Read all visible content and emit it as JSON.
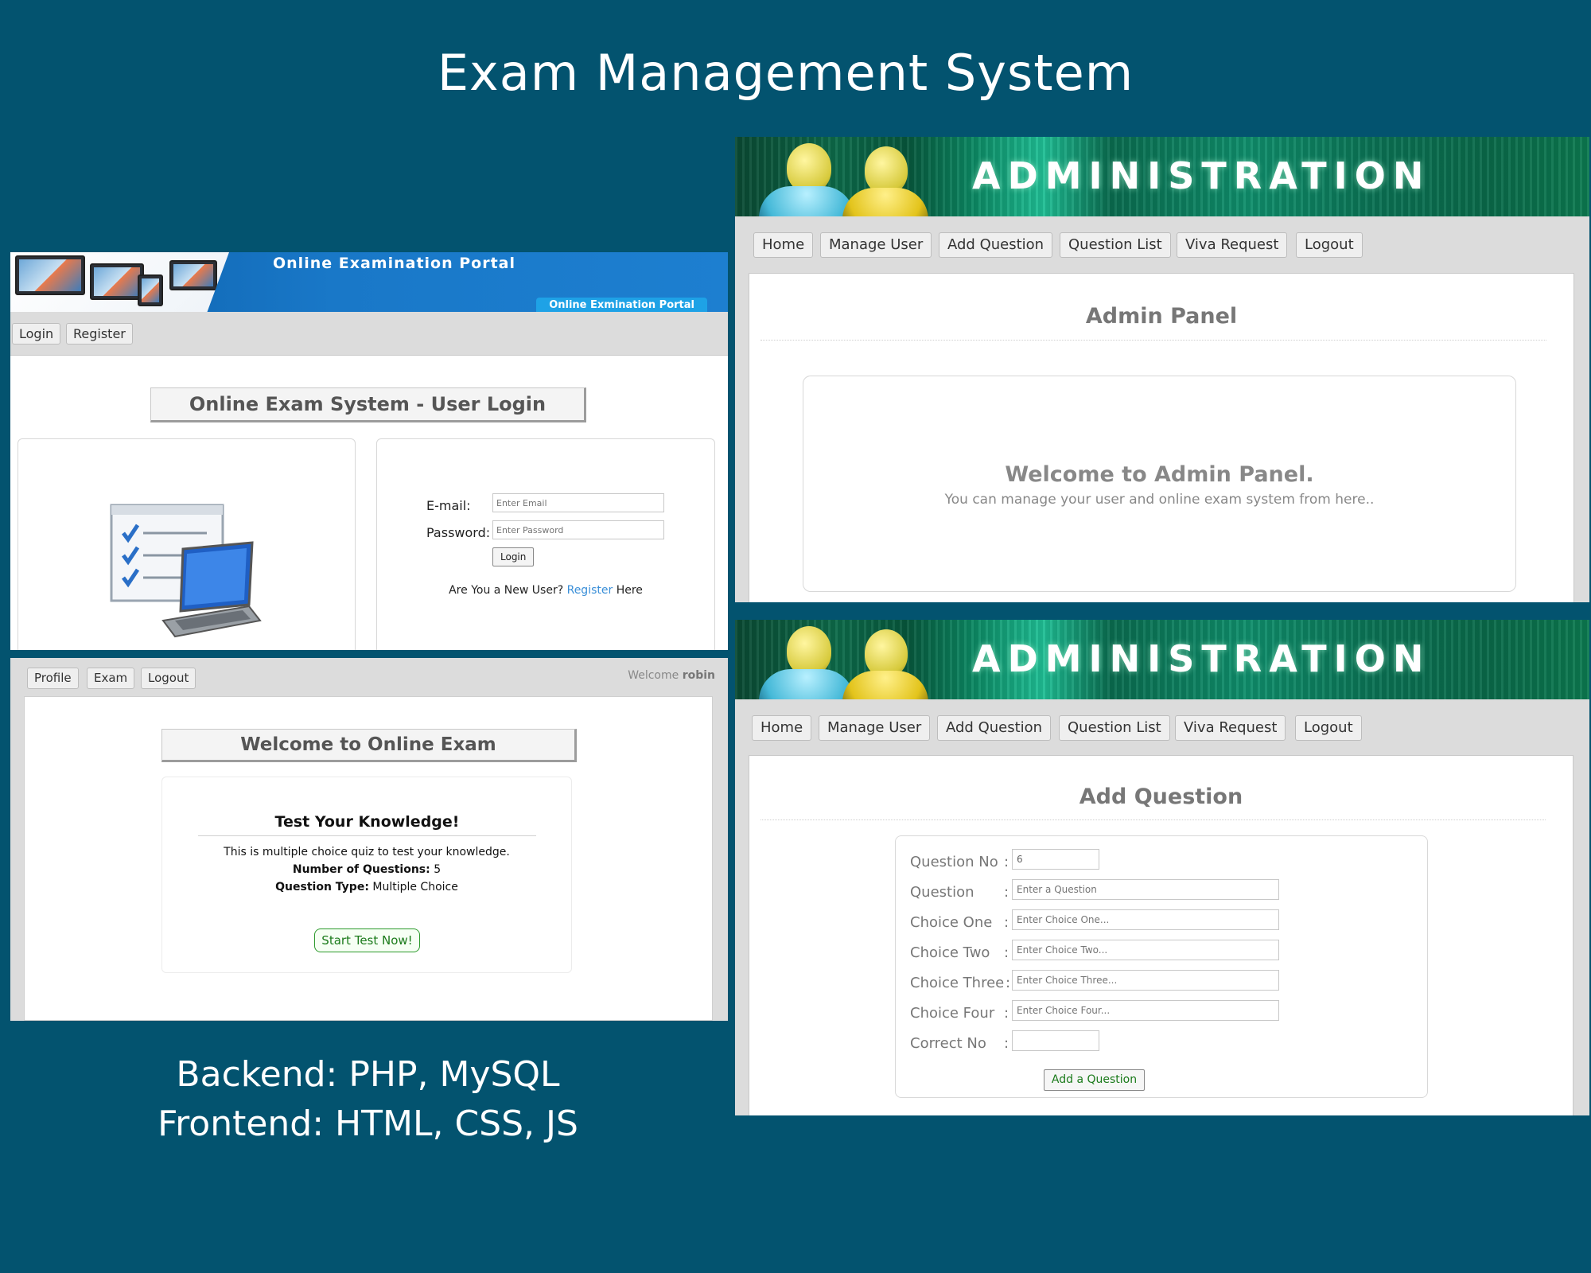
{
  "page": {
    "title": "Exam Management System",
    "tech": {
      "backend": "Backend: PHP, MySQL",
      "frontend": "Frontend: HTML, CSS, JS"
    }
  },
  "login_panel": {
    "banner_title": "Online Examination Portal",
    "banner_sub": "Online Exmination Portal",
    "nav": [
      "Login",
      "Register"
    ],
    "heading": "Online Exam System - User Login",
    "email_label": "E-mail:",
    "email_placeholder": "Enter Email",
    "password_label": "Password:",
    "password_placeholder": "Enter Password",
    "login_button": "Login",
    "register_prefix": "Are You a New User?",
    "register_link": "Register",
    "register_suffix": "Here"
  },
  "exam_panel": {
    "nav": [
      "Profile",
      "Exam",
      "Logout"
    ],
    "welcome_prefix": "Welcome",
    "username": "robin",
    "heading": "Welcome to Online Exam",
    "quiz_title": "Test Your Knowledge!",
    "quiz_desc": "This is multiple choice quiz to test your knowledge.",
    "num_questions_label": "Number of Questions:",
    "num_questions_value": "5",
    "question_type_label": "Question Type:",
    "question_type_value": "Multiple Choice",
    "start_button": "Start Test Now!"
  },
  "admin_panel": {
    "banner_text": "ADMINISTRATION",
    "nav": [
      "Home",
      "Manage User",
      "Add Question",
      "Question List",
      "Viva Request",
      "Logout"
    ],
    "title": "Admin Panel",
    "welcome_title": "Welcome to Admin Panel.",
    "welcome_text": "You can manage your user and online exam system from here.."
  },
  "add_question_panel": {
    "banner_text": "ADMINISTRATION",
    "nav": [
      "Home",
      "Manage User",
      "Add Question",
      "Question List",
      "Viva Request",
      "Logout"
    ],
    "title": "Add Question",
    "fields": [
      {
        "label": "Question No",
        "value": "6",
        "placeholder": ""
      },
      {
        "label": "Question",
        "value": "",
        "placeholder": "Enter a Question"
      },
      {
        "label": "Choice One",
        "value": "",
        "placeholder": "Enter Choice One..."
      },
      {
        "label": "Choice Two",
        "value": "",
        "placeholder": "Enter Choice Two..."
      },
      {
        "label": "Choice Three",
        "value": "",
        "placeholder": "Enter Choice Three..."
      },
      {
        "label": "Choice Four",
        "value": "",
        "placeholder": "Enter Choice Four..."
      },
      {
        "label": "Correct No",
        "value": "",
        "placeholder": ""
      }
    ],
    "colon": ":",
    "submit_button": "Add a Question"
  }
}
